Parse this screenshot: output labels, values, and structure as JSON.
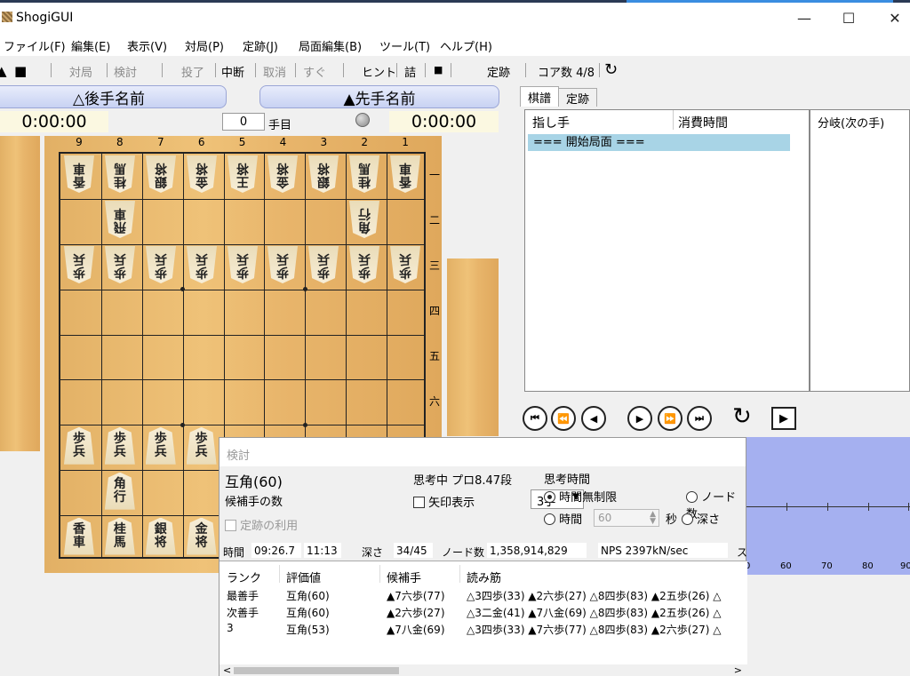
{
  "window": {
    "title": "ShogiGUI",
    "controls": [
      "—",
      "☐",
      "✕"
    ]
  },
  "menu": [
    "ファイル(F)",
    "編集(E)",
    "表示(V)",
    "対局(P)",
    "定跡(J)",
    "局面編集(B)",
    "ツール(T)",
    "ヘルプ(H)"
  ],
  "toolbar": {
    "items": [
      "対局",
      "検討",
      "投了",
      "中断",
      "取消",
      "すぐ",
      "ヒント",
      "詰",
      "■",
      "定跡",
      "コア数  4/8"
    ]
  },
  "players": {
    "gote_name": "△後手名前",
    "sente_name": "▲先手名前"
  },
  "clocks": {
    "gote": "0:00:00",
    "sente": "0:00:00"
  },
  "move": {
    "number": "0",
    "label": "手目"
  },
  "board": {
    "files": [
      "9",
      "8",
      "7",
      "6",
      "5",
      "4",
      "3",
      "2",
      "1"
    ],
    "ranks": [
      "一",
      "二",
      "三",
      "四",
      "五",
      "六"
    ],
    "gote_pieces": [
      {
        "c": 0,
        "r": 0,
        "t": "香車"
      },
      {
        "c": 1,
        "r": 0,
        "t": "桂馬"
      },
      {
        "c": 2,
        "r": 0,
        "t": "銀将"
      },
      {
        "c": 3,
        "r": 0,
        "t": "金将"
      },
      {
        "c": 4,
        "r": 0,
        "t": "王将"
      },
      {
        "c": 5,
        "r": 0,
        "t": "金将"
      },
      {
        "c": 6,
        "r": 0,
        "t": "銀将"
      },
      {
        "c": 7,
        "r": 0,
        "t": "桂馬"
      },
      {
        "c": 8,
        "r": 0,
        "t": "香車"
      },
      {
        "c": 1,
        "r": 1,
        "t": "飛車"
      },
      {
        "c": 7,
        "r": 1,
        "t": "角行"
      },
      {
        "c": 0,
        "r": 2,
        "t": "歩兵"
      },
      {
        "c": 1,
        "r": 2,
        "t": "歩兵"
      },
      {
        "c": 2,
        "r": 2,
        "t": "歩兵"
      },
      {
        "c": 3,
        "r": 2,
        "t": "歩兵"
      },
      {
        "c": 4,
        "r": 2,
        "t": "歩兵"
      },
      {
        "c": 5,
        "r": 2,
        "t": "歩兵"
      },
      {
        "c": 6,
        "r": 2,
        "t": "歩兵"
      },
      {
        "c": 7,
        "r": 2,
        "t": "歩兵"
      },
      {
        "c": 8,
        "r": 2,
        "t": "歩兵"
      }
    ],
    "sente_pieces": [
      {
        "c": 0,
        "r": 6,
        "t": "歩兵"
      },
      {
        "c": 1,
        "r": 6,
        "t": "歩兵"
      },
      {
        "c": 2,
        "r": 6,
        "t": "歩兵"
      },
      {
        "c": 3,
        "r": 6,
        "t": "歩兵"
      },
      {
        "c": 1,
        "r": 7,
        "t": "角行"
      },
      {
        "c": 0,
        "r": 8,
        "t": "香車"
      },
      {
        "c": 1,
        "r": 8,
        "t": "桂馬"
      },
      {
        "c": 2,
        "r": 8,
        "t": "銀将"
      },
      {
        "c": 3,
        "r": 8,
        "t": "金将"
      }
    ]
  },
  "tabs": [
    "棋譜",
    "定跡"
  ],
  "kifu": {
    "col_move": "指し手",
    "col_time": "消費時間",
    "col_branch": "分岐(次の手)",
    "rows": [
      "=== 開始局面 ==="
    ]
  },
  "nav": [
    "⏮",
    "⏪",
    "◀",
    "▶",
    "⏩",
    "⏭",
    "↻",
    "▶"
  ],
  "eval_graph": {
    "ticks": [
      "60",
      "70",
      "80",
      "90"
    ]
  },
  "analysis": {
    "title": "検討",
    "best": "互角(60)",
    "candidates_label": "候補手の数",
    "candidates_value": "3手",
    "thinking": "思考中 プロ8.47段",
    "arrow_label": "矢印表示",
    "joseki_label": "定跡の利用",
    "time_group": "思考時間",
    "unlimited": "時間無制限",
    "nodes": "ノード数",
    "time": "時間",
    "time_value": "60",
    "sec": "秒",
    "depth": "深さ",
    "status": {
      "time_label": "時間",
      "time_value": "09:26.7",
      "time2": "11:13",
      "depth_label": "深さ",
      "depth_value": "34/45",
      "nodes_label": "ノード数",
      "nodes_value": "1,358,914,829",
      "nps": "NPS  2397kN/sec",
      "tail": "ス"
    },
    "pv_headers": [
      "ランク",
      "評価値",
      "候補手",
      "読み筋"
    ],
    "pv_rows": [
      {
        "rank": "最善手",
        "score": "互角(60)",
        "move": "▲7六歩(77)",
        "pv": "△3四歩(33) ▲2六歩(27) △8四歩(83) ▲2五歩(26) △"
      },
      {
        "rank": "次善手",
        "score": "互角(60)",
        "move": "▲2六歩(27)",
        "pv": "△3二金(41) ▲7八金(69) △8四歩(83) ▲2五歩(26) △"
      },
      {
        "rank": "3",
        "score": "互角(53)",
        "move": "▲7八金(69)",
        "pv": "△3四歩(33) ▲7六歩(77) △8四歩(83) ▲2六歩(27) △"
      }
    ]
  }
}
